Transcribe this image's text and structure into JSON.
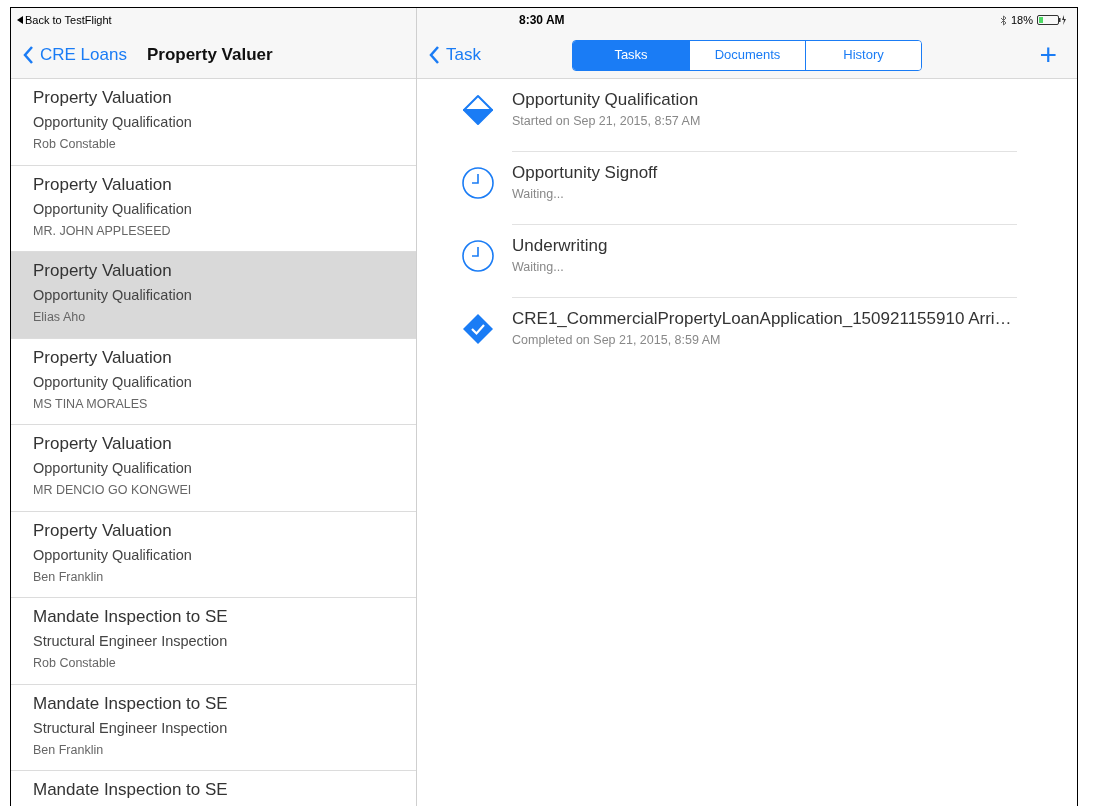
{
  "status_bar": {
    "back_label": "Back to TestFlight",
    "time": "8:30 AM",
    "battery": "18%"
  },
  "master": {
    "back_button": "CRE Loans",
    "title": "Property Valuer",
    "items": [
      {
        "title": "Property Valuation",
        "subtitle": "Opportunity Qualification",
        "assignee": "Rob Constable",
        "selected": false
      },
      {
        "title": "Property Valuation",
        "subtitle": "Opportunity Qualification",
        "assignee": "MR. JOHN APPLESEED",
        "selected": false
      },
      {
        "title": "Property Valuation",
        "subtitle": "Opportunity Qualification",
        "assignee": "Elias Aho",
        "selected": true
      },
      {
        "title": "Property Valuation",
        "subtitle": "Opportunity Qualification",
        "assignee": "MS TINA MORALES",
        "selected": false
      },
      {
        "title": "Property Valuation",
        "subtitle": "Opportunity Qualification",
        "assignee": "MR DENCIO GO KONGWEI",
        "selected": false
      },
      {
        "title": "Property Valuation",
        "subtitle": "Opportunity Qualification",
        "assignee": "Ben Franklin",
        "selected": false
      },
      {
        "title": "Mandate Inspection to SE",
        "subtitle": "Structural Engineer Inspection",
        "assignee": "Rob Constable",
        "selected": false
      },
      {
        "title": "Mandate Inspection to SE",
        "subtitle": "Structural Engineer Inspection",
        "assignee": "Ben Franklin",
        "selected": false
      },
      {
        "title": "Mandate Inspection to SE",
        "selected": false
      }
    ]
  },
  "detail": {
    "back_button": "Task",
    "tabs": [
      {
        "label": "Tasks",
        "selected": true
      },
      {
        "label": "Documents",
        "selected": false
      },
      {
        "label": "History",
        "selected": false
      }
    ],
    "add_button": "+",
    "tasks": [
      {
        "kind": "in_progress",
        "title": "Opportunity Qualification",
        "status": "Started on Sep 21, 2015, 8:57 AM"
      },
      {
        "kind": "waiting",
        "title": "Opportunity Signoff",
        "status": "Waiting..."
      },
      {
        "kind": "waiting",
        "title": "Underwriting",
        "status": "Waiting..."
      },
      {
        "kind": "completed",
        "title": "CRE1_CommercialPropertyLoanApplication_150921155910 Arri…",
        "status": "Completed on Sep 21, 2015, 8:59 AM"
      }
    ]
  }
}
